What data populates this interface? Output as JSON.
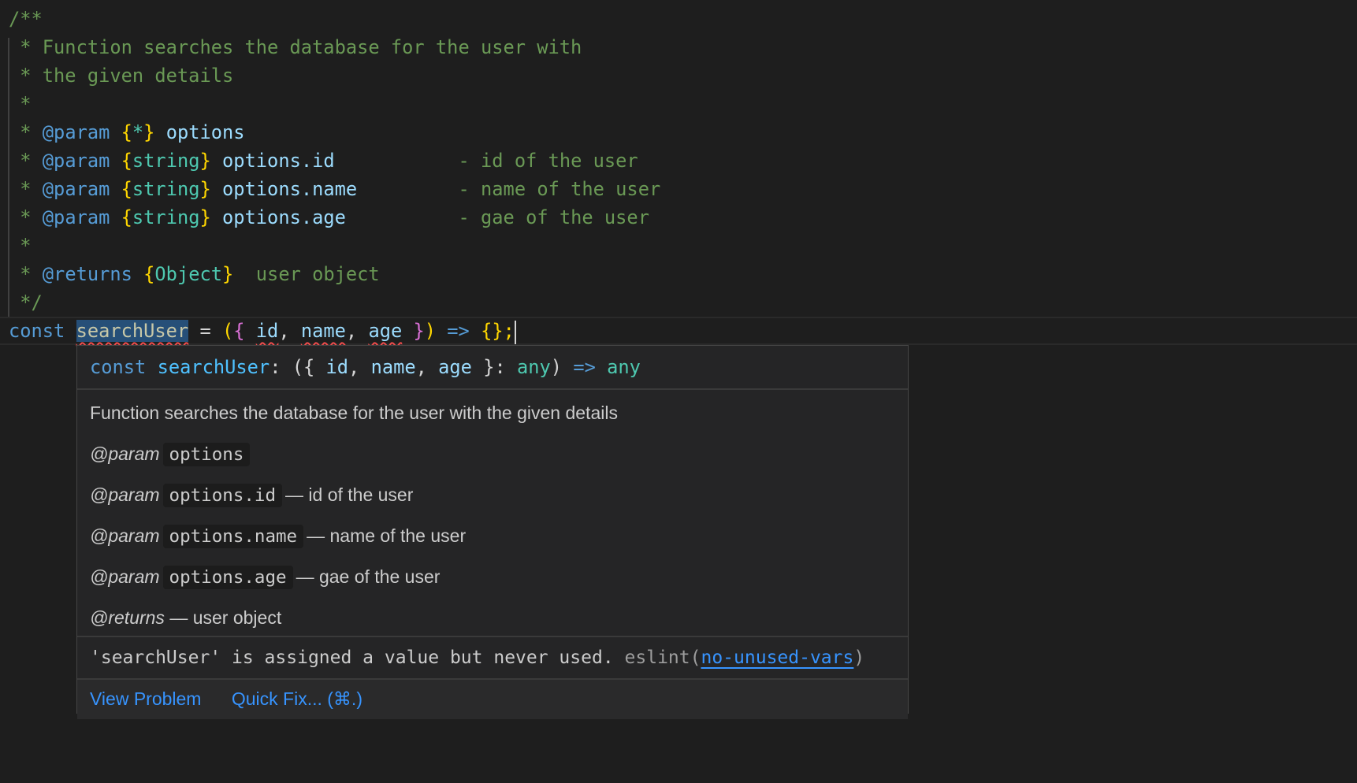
{
  "code": {
    "lines": [
      "/**",
      " * Function searches the database for the user with",
      " * the given details",
      " *"
    ],
    "param_tag": "@param",
    "returns_tag": "@returns",
    "star": " * ",
    "params": [
      {
        "type": "{*}",
        "name": "options",
        "desc": ""
      },
      {
        "type": "{string}",
        "name": "options.id",
        "desc": "- id of the user"
      },
      {
        "type": "{string}",
        "name": "options.name",
        "desc": "- name of the user"
      },
      {
        "type": "{string}",
        "name": "options.age",
        "desc": "- gae of the user"
      }
    ],
    "returns_type": "{Object}",
    "returns_desc": "user object",
    "close": " */",
    "decl": {
      "kw": "const",
      "name": "searchUser",
      "eq": " = ",
      "params": [
        "id",
        "name",
        "age"
      ],
      "arrow": "=>",
      "body": "{};"
    }
  },
  "hover": {
    "signature": {
      "kw": "const",
      "name": "searchUser",
      "params": [
        "id",
        "name",
        "age"
      ],
      "type": "any",
      "arrow": "=>",
      "ret": "any"
    },
    "summary": "Function searches the database for the user with the given details",
    "param_tag": "@param",
    "returns_tag": "@returns",
    "params": [
      {
        "name": "options",
        "desc": ""
      },
      {
        "name": "options.id",
        "desc": "— id of the user"
      },
      {
        "name": "options.name",
        "desc": "— name of the user"
      },
      {
        "name": "options.age",
        "desc": "— gae of the user"
      }
    ],
    "returns_desc": "— user object",
    "problem": {
      "message": "'searchUser' is assigned a value but never used.",
      "source": "eslint",
      "rule": "no-unused-vars"
    },
    "actions": {
      "view_problem": "View Problem",
      "quick_fix": "Quick Fix... (⌘.)"
    }
  },
  "colors": {
    "background": "#1e1e1e",
    "comment": "#6a9955",
    "keyword": "#569cd6",
    "link": "#3794ff",
    "error_squiggle": "#f14c4c"
  }
}
